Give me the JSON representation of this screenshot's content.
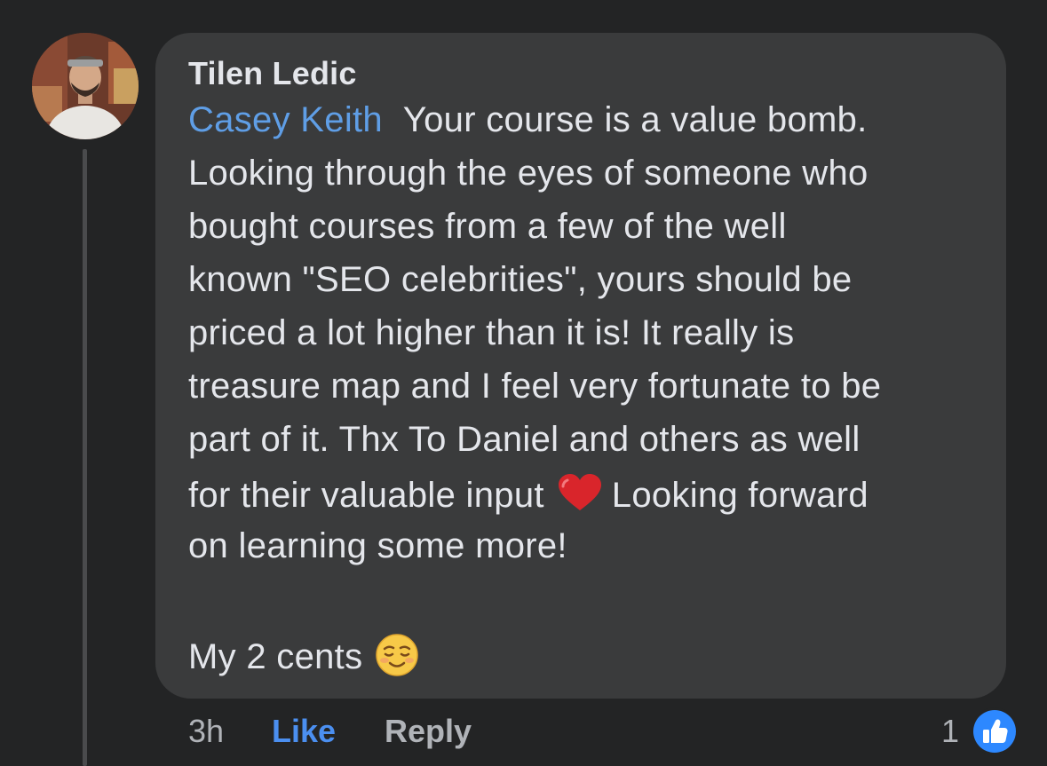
{
  "comment": {
    "author": "Tilen Ledic",
    "mention": "Casey Keith",
    "lines": [
      "Your course is a value bomb.",
      "Looking through the eyes of someone who",
      "bought courses from a few of the well",
      "known \"SEO celebrities\", yours should be",
      "priced a lot higher than it is! It really is",
      "treasure map and I feel very fortunate to be",
      "part of it. Thx To Daniel and others as well",
      "for their valuable input",
      "Looking forward",
      "on learning some more!"
    ],
    "closing": "My 2 cents",
    "emojis": {
      "heart": "red-heart-emoji",
      "smile": "smiling-face-emoji"
    }
  },
  "footer": {
    "time": "3h",
    "like_label": "Like",
    "reply_label": "Reply",
    "reaction_count": "1",
    "reaction_icon": "thumbs-up-icon"
  },
  "colors": {
    "background": "#232425",
    "bubble": "#3a3b3c",
    "text": "#e4e6eb",
    "mention": "#5f9ee6",
    "like_active": "#4b8ff0",
    "muted": "#b0b3b8",
    "reaction_badge": "#2d88ff"
  }
}
